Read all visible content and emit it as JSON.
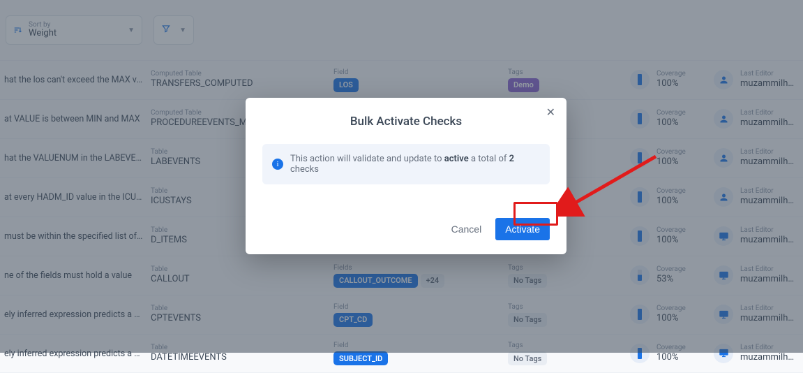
{
  "toolbar": {
    "sort_label": "Sort by",
    "sort_value": "Weight"
  },
  "columns": {
    "computed_table": "Computed Table",
    "table": "Table",
    "field": "Field",
    "fields": "Fields",
    "tags": "Tags",
    "coverage": "Coverage",
    "last_editor": "Last Editor",
    "no_tags": "No Tags"
  },
  "rows": [
    {
      "desc": "hat the los can't exceed the MAX value…",
      "tbl_type": "computed_table",
      "tbl": "TRANSFERS_COMPUTED",
      "field_single": "LOS",
      "tag": "Demo",
      "coverage": "100%",
      "cov_style": "full",
      "editor_icon": "user",
      "editor": "muzammilhasa."
    },
    {
      "desc": "at VALUE is between MIN and MAX",
      "tbl_type": "computed_table",
      "tbl": "PROCEDUREEVENTS_M…",
      "field_single": "",
      "coverage": "100%",
      "cov_style": "full",
      "editor_icon": "user",
      "editor": "muzammilhasa."
    },
    {
      "desc": "hat the VALUENUM in the LABEVENTS…",
      "tbl_type": "table",
      "tbl": "LABEVENTS",
      "coverage": "100%",
      "cov_style": "full",
      "editor_icon": "user",
      "editor": "muzammilhasa."
    },
    {
      "desc": "at every HADM_ID value in the ICUS…",
      "tbl_type": "table",
      "tbl": "ICUSTAYS",
      "coverage": "100%",
      "cov_style": "full",
      "editor_icon": "user",
      "editor": "muzammilhasa."
    },
    {
      "desc": "must be within the specified list of v…",
      "tbl_type": "table",
      "tbl": "D_ITEMS",
      "coverage": "100%",
      "cov_style": "full",
      "editor_icon": "monitor",
      "editor": "muzammilhasa."
    },
    {
      "desc": "ne of the fields must hold a value",
      "tbl_type": "table",
      "tbl": "CALLOUT",
      "fields_multi_first": "CALLOUT_OUTCOME",
      "fields_multi_extra": "+24",
      "tags_none": true,
      "coverage": "53%",
      "cov_style": "partial",
      "editor_icon": "monitor",
      "editor": "muzammilhasa."
    },
    {
      "desc": "ely inferred expression predicts a val…",
      "tbl_type": "table",
      "tbl": "CPTEVENTS",
      "field_single": "CPT_CD",
      "tags_none": true,
      "coverage": "100%",
      "cov_style": "full",
      "editor_icon": "monitor",
      "editor": "muzammilhasa."
    },
    {
      "desc": "ely inferred expression predicts a val…",
      "tbl_type": "table",
      "tbl": "DATETIMEEVENTS",
      "field_single": "SUBJECT_ID",
      "tags_none": true,
      "coverage": "100%",
      "cov_style": "full",
      "editor_icon": "monitor",
      "editor": "muzammilhasa."
    }
  ],
  "dialog": {
    "title": "Bulk Activate Checks",
    "info_pre": "This action will validate and update to ",
    "info_strong1": "active",
    "info_mid": " a total of ",
    "info_strong2": "2",
    "info_post": " checks",
    "cancel": "Cancel",
    "activate": "Activate"
  }
}
